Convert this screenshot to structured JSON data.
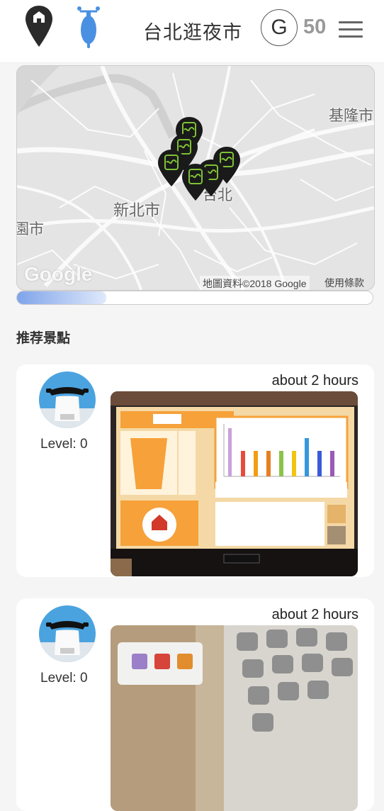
{
  "header": {
    "title": "台北逛夜市",
    "badge_letter": "G",
    "coins": "50"
  },
  "map": {
    "labels": {
      "keelung": "基隆市",
      "new_taipei": "新北市",
      "taipei": "台北",
      "taoyuan_partial": "園市"
    },
    "logo_text": "Google",
    "attribution": "地圖資料©2018 Google",
    "terms_link": "使用條款",
    "marker_icon": "juice-cup-marker-icon",
    "marker_color": "#1a1a1a",
    "marker_accent": "#7ec234"
  },
  "progress": {
    "value": 0.25
  },
  "section": {
    "title": "推荐景點"
  },
  "cards": [
    {
      "duration": "about 2 hours",
      "level": "Level: 0",
      "avatar_icon": "scooter-avatar-icon",
      "photo_icon": "juice-kiosk-photo"
    },
    {
      "duration": "about 2 hours",
      "level": "Level: 0",
      "avatar_icon": "scooter-avatar-icon",
      "photo_icon": "keypad-photo"
    }
  ]
}
